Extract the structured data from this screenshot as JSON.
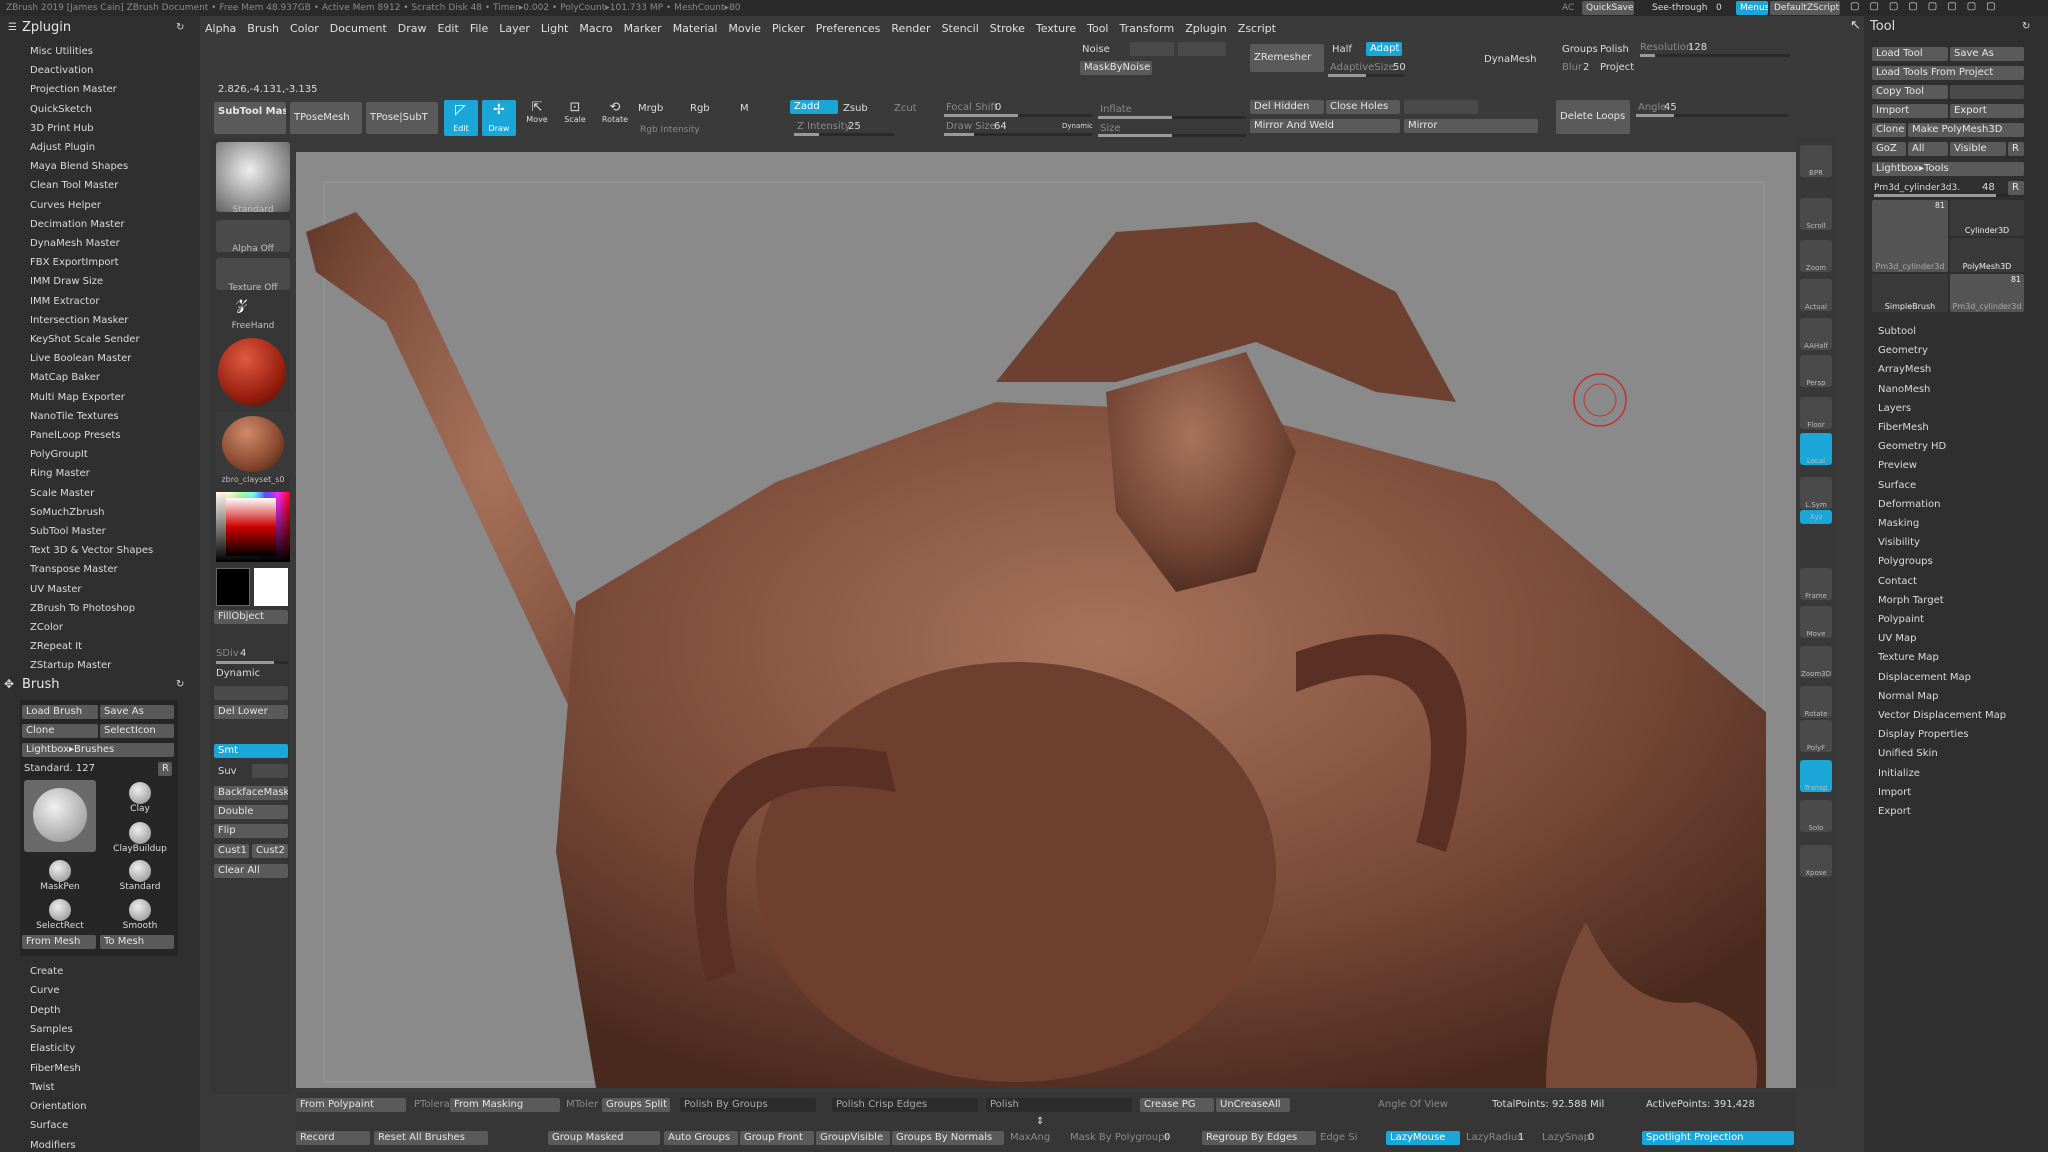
{
  "titlebar": {
    "text": "ZBrush 2019 [James Cain]   ZBrush Document   • Free Mem 48.937GB • Active Mem 8912 • Scratch Disk 48 • Timer▸0.002 • PolyCount▸101.733 MP • MeshCount▸80",
    "ac": "AC",
    "quicksave": "QuickSave",
    "see_through": "See-through",
    "see_through_val": "0",
    "menus": "Menus",
    "default_zscript": "DefaultZScript"
  },
  "menubar": [
    "Alpha",
    "Brush",
    "Color",
    "Document",
    "Draw",
    "Edit",
    "File",
    "Layer",
    "Light",
    "Macro",
    "Marker",
    "Material",
    "Movie",
    "Picker",
    "Preferences",
    "Render",
    "Stencil",
    "Stroke",
    "Texture",
    "Tool",
    "Transform",
    "Zplugin",
    "Zscript"
  ],
  "zplugin": {
    "title": "Zplugin",
    "items": [
      "Misc Utilities",
      "Deactivation",
      "Projection Master",
      "QuickSketch",
      "3D Print Hub",
      "Adjust Plugin",
      "Maya Blend Shapes",
      "Clean Tool Master",
      "Curves Helper",
      "Decimation Master",
      "DynaMesh Master",
      "FBX ExportImport",
      "IMM Draw Size",
      "IMM Extractor",
      "Intersection Masker",
      "KeyShot Scale Sender",
      "Live Boolean Master",
      "MatCap Baker",
      "Multi Map Exporter",
      "NanoTile Textures",
      "PanelLoop Presets",
      "PolyGroupIt",
      "Ring Master",
      "Scale Master",
      "SoMuchZbrush",
      "SubTool Master",
      "Text 3D & Vector Shapes",
      "Transpose Master",
      "UV Master",
      "ZBrush To Photoshop",
      "ZColor",
      "ZRepeat It",
      "ZStartup Master"
    ]
  },
  "brush": {
    "title": "Brush",
    "load": "Load Brush",
    "save_as": "Save As",
    "clone": "Clone",
    "select_icon": "SelectIcon",
    "lightbox": "Lightbox▸Brushes",
    "current": "Standard. 127",
    "r": "R",
    "thumbs": [
      "Standard",
      "Clay",
      "ClayBuildup",
      "MaskPen",
      "Standard",
      "SelectRect",
      "Smooth"
    ],
    "from_mesh": "From Mesh",
    "to_mesh": "To Mesh",
    "sections": [
      "Create",
      "Curve",
      "Depth",
      "Samples",
      "Elasticity",
      "FiberMesh",
      "Twist",
      "Orientation",
      "Surface",
      "Modifiers"
    ]
  },
  "coords": "2.826,-4.131,-3.135",
  "toolbar": {
    "subtool_master": "SubTool Master",
    "tposemesh": "TPoseMesh",
    "tpose_subt": "TPose|SubT",
    "edit": "Edit",
    "draw": "Draw",
    "move": "Move",
    "scale": "Scale",
    "rotate": "Rotate",
    "mrgb": "Mrgb",
    "rgb": "Rgb",
    "m": "M",
    "zadd": "Zadd",
    "zsub": "Zsub",
    "zcut": "Zcut",
    "rgb_intensity": "Rgb Intensity",
    "z_intensity": "Z Intensity",
    "z_intensity_val": "25",
    "focal_shift": "Focal Shift",
    "focal_shift_val": "0",
    "draw_size": "Draw Size",
    "draw_size_val": "64",
    "dynamic": "Dynamic",
    "inflate": "Inflate",
    "size": "Size",
    "noise": "Noise",
    "mask_by_noise": "MaskByNoise",
    "zremesher": "ZRemesher",
    "half": "Half",
    "adapt": "Adapt",
    "adaptive_size": "AdaptiveSize",
    "adaptive_size_val": "50",
    "dynamesh": "DynaMesh",
    "groups": "Groups",
    "polish": "Polish",
    "blur": "Blur",
    "blur_val": "2",
    "project": "Project",
    "resolution": "Resolution",
    "resolution_val": "128",
    "del_hidden": "Del Hidden",
    "close_holes": "Close Holes",
    "mirror_and_weld": "Mirror And Weld",
    "mirror": "Mirror",
    "delete_loops": "Delete Loops",
    "angle": "Angle",
    "angle_val": "45"
  },
  "toolcol": {
    "standard": "Standard",
    "alpha_off": "Alpha Off",
    "texture_off": "Texture Off",
    "freehand": "FreeHand",
    "material": "zbro_clayset_s0",
    "fill_object": "FillObject",
    "sdiv": "SDiv",
    "sdiv_val": "4",
    "dynamic": "Dynamic",
    "del_lower": "Del Lower",
    "smt": "Smt",
    "suv": "Suv",
    "backface_mask": "BackfaceMask",
    "double": "Double",
    "flip": "Flip",
    "cust1": "Cust1",
    "cust2": "Cust2",
    "clear_all": "Clear All"
  },
  "shelf": [
    "BPR",
    "Scroll",
    "Zoom",
    "Actual",
    "AAHalf",
    "Persp",
    "Floor",
    "Local",
    "L.Sym",
    "Xyz",
    "Frame",
    "Move",
    "Zoom3D",
    "Rotate",
    "PolyF",
    "Transp",
    "Solo",
    "Xpose"
  ],
  "tool": {
    "title": "Tool",
    "load": "Load Tool",
    "save_as": "Save As",
    "load_from_project": "Load Tools From Project",
    "copy_tool": "Copy Tool",
    "import": "Import",
    "export": "Export",
    "clone": "Clone",
    "make_polymesh": "Make PolyMesh3D",
    "goz": "GoZ",
    "all": "All",
    "visible": "Visible",
    "r": "R",
    "lightbox": "Lightbox▸Tools",
    "current": "Pm3d_cylinder3d3.",
    "current_val": "48",
    "thumbs": [
      "Pm3d_cylinder3d",
      "Cylinder3D",
      "PolyMesh3D",
      "SimpleBrush",
      "Pm3d_cylinder3d"
    ],
    "badge": "81",
    "sections": [
      "Subtool",
      "Geometry",
      "ArrayMesh",
      "NanoMesh",
      "Layers",
      "FiberMesh",
      "Geometry HD",
      "Preview",
      "Surface",
      "Deformation",
      "Masking",
      "Visibility",
      "Polygroups",
      "Contact",
      "Morph Target",
      "Polypaint",
      "UV Map",
      "Texture Map",
      "Displacement Map",
      "Normal Map",
      "Vector Displacement Map",
      "Display Properties",
      "Unified Skin",
      "Initialize",
      "Import",
      "Export"
    ]
  },
  "bottom": {
    "from_polypaint": "From Polypaint",
    "ptolerance": "PTolera",
    "from_masking": "From Masking",
    "mtolerance": "MToler",
    "groups_split": "Groups Split",
    "polish_by_groups": "Polish By Groups",
    "polish_crisp_edges": "Polish Crisp Edges",
    "polish": "Polish",
    "crease_pg": "Crease PG",
    "uncrease_all": "UnCreaseAll",
    "angle_of_view": "Angle Of View",
    "total_points": "TotalPoints: 92.588 Mil",
    "active_points": "ActivePoints: 391,428",
    "record": "Record",
    "reset_all_brushes": "Reset All Brushes",
    "group_masked": "Group Masked",
    "auto_groups": "Auto Groups",
    "group_front": "Group Front",
    "group_visible": "GroupVisible",
    "groups_by_normals": "Groups By Normals",
    "max_angle": "MaxAng",
    "mask_by_polygroups": "Mask By Polygroups",
    "mask_by_polygroups_val": "0",
    "regroup_by_edges": "Regroup By Edges",
    "edge_s": "Edge Si",
    "lazy_mouse": "LazyMouse",
    "lazy_radius": "LazyRadius",
    "lazy_radius_val": "1",
    "lazy_snap": "LazySnap",
    "lazy_snap_val": "0",
    "spotlight_projection": "Spotlight Projection"
  },
  "colors": {
    "accent": "#1aa6d6",
    "model": "#7a4a38",
    "canvas": "#8a8a8a",
    "panel": "#2f2f2f"
  }
}
